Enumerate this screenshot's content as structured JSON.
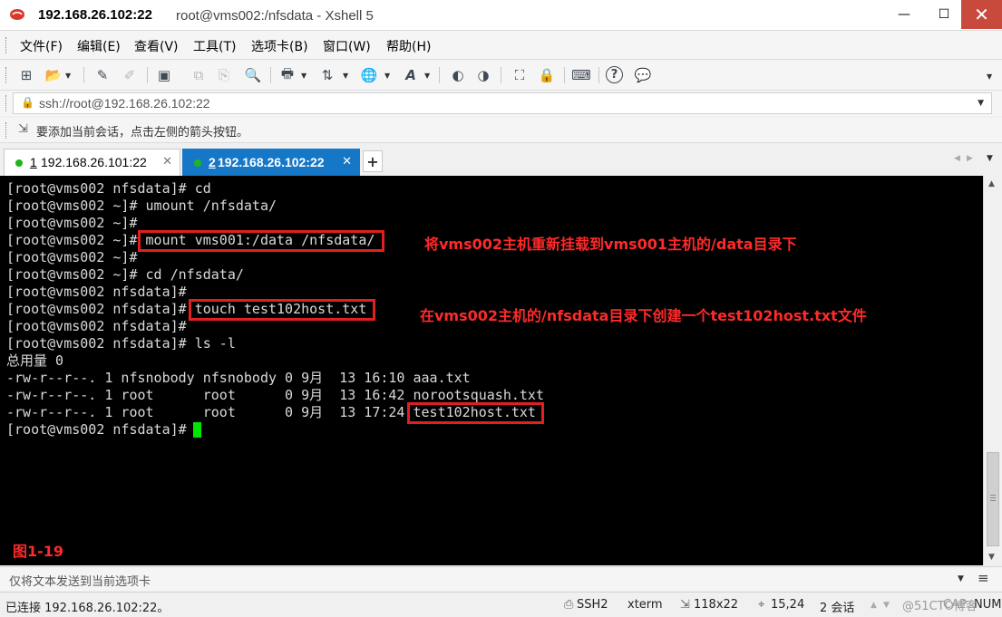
{
  "window": {
    "title_host": "192.168.26.102:22",
    "title_rest": "root@vms002:/nfsdata - Xshell 5",
    "minimize_label": "—",
    "maximize_label": "☐",
    "close_label": "✕"
  },
  "menu": [
    "文件(F)",
    "编辑(E)",
    "查看(V)",
    "工具(T)",
    "选项卡(B)",
    "窗口(W)",
    "帮助(H)"
  ],
  "toolbar": {
    "icons": [
      "new-session-icon",
      "open-folder-icon",
      "pen-icon",
      "pen-disabled-icon",
      "properties-icon",
      "copy-icon",
      "paste-icon",
      "find-icon",
      "print-icon",
      "transfer-icon",
      "globe-icon",
      "font-icon",
      "xftp-icon",
      "xmanager-icon",
      "fullscreen-icon",
      "lock-icon",
      "keyboard-icon",
      "help-icon",
      "chat-icon"
    ],
    "glyphs": {
      "new": "⊞",
      "open": "📂",
      "pen": "✎",
      "pen2": "✐",
      "props": "▣",
      "copy": "⧉",
      "paste": "⎘",
      "find": "🔍",
      "print": "🖶",
      "transfer": "⇅",
      "globe": "🌐",
      "font": "A",
      "xftp": "◐",
      "xmanager": "◑",
      "fullscreen": "⛶",
      "lock": "🔒",
      "keyboard": "⌨",
      "help": "?",
      "chat": "💬"
    }
  },
  "address": {
    "lock_glyph": "🔒",
    "value": "ssh://root@192.168.26.102:22"
  },
  "hint": {
    "glyph": "⇲",
    "text": "要添加当前会话，点击左侧的箭头按钮。"
  },
  "tabs": [
    {
      "num": "1",
      "label": " 192.168.26.101:22",
      "active": false
    },
    {
      "num": "2",
      "label": " 192.168.26.102:22",
      "active": true
    }
  ],
  "tab_close": "✕",
  "tab_add": "+",
  "tab_nav": {
    "left": "◀",
    "right": "▶",
    "menu": "▼"
  },
  "terminal": {
    "lines": [
      "[root@vms002 nfsdata]# cd",
      "[root@vms002 ~]# umount /nfsdata/",
      "[root@vms002 ~]#",
      "[root@vms002 ~]# mount vms001:/data /nfsdata/",
      "[root@vms002 ~]#",
      "[root@vms002 ~]# cd /nfsdata/",
      "[root@vms002 nfsdata]#",
      "[root@vms002 nfsdata]# touch test102host.txt",
      "[root@vms002 nfsdata]#",
      "[root@vms002 nfsdata]# ls -l",
      "总用量 0",
      "-rw-r--r--. 1 nfsnobody nfsnobody 0 9月  13 16:10 aaa.txt",
      "-rw-r--r--. 1 root      root      0 9月  13 16:42 norootsquash.txt",
      "-rw-r--r--. 1 root      root      0 9月  13 17:24 test102host.txt",
      "[root@vms002 nfsdata]#"
    ],
    "annotations": [
      "将vms002主机重新挂载到vms001主机的/data目录下",
      "在vms002主机的/nfsdata目录下创建一个test102host.txt文件"
    ],
    "figure_label": "图1-19",
    "highlight_color": "#e02020",
    "cursor_color": "#00e600"
  },
  "scrollbar": {
    "up": "▲",
    "down": "▼"
  },
  "sendbar": {
    "placeholder": "仅将文本发送到当前选项卡",
    "dropdown": "▼",
    "menu": "≡"
  },
  "status": {
    "connection": "已连接 192.168.26.102:22。",
    "protocol": "SSH2",
    "term": "xterm",
    "size": "118x22",
    "position": "15,24",
    "sessions": "2 会话",
    "caps": "CAP",
    "num": "NUM",
    "arrows_up": "▲",
    "arrows_down": "▼",
    "protocol_icon": "⎙",
    "size_icon": "⇲",
    "pos_icon": "⌖",
    "watermark": "@51CTO博客"
  },
  "colors": {
    "tab_active": "#1777c7",
    "close_button": "#c74a3c",
    "annotation": "#ff2a2a"
  }
}
